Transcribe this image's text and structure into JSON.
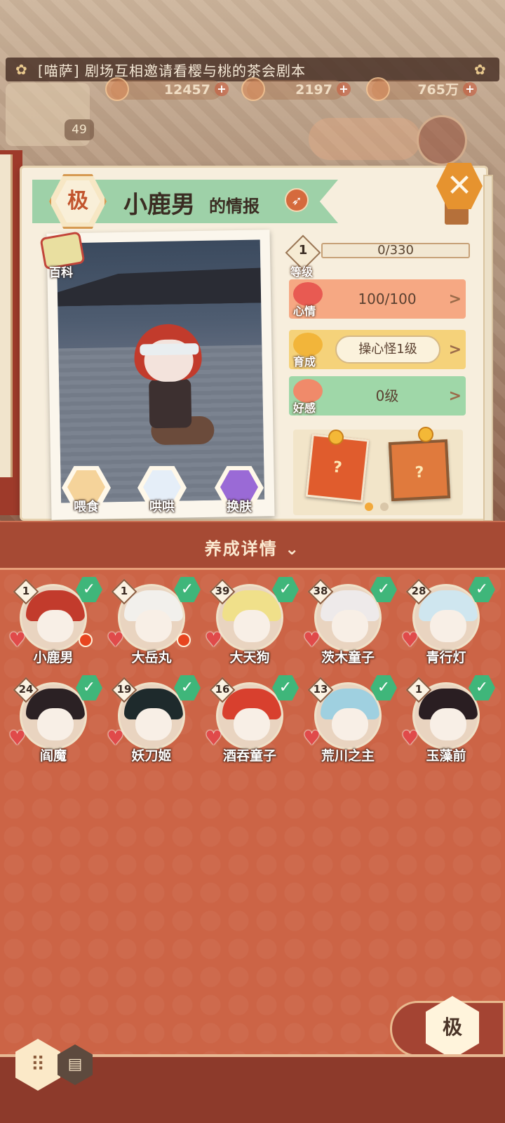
{
  "ticker": {
    "text": "[喵萨] 剧场互相邀请看樱与桃的茶会剧本"
  },
  "currencies": [
    {
      "icon": "food-icon",
      "value": "12457"
    },
    {
      "icon": "lantern-icon",
      "value": "2197"
    },
    {
      "icon": "coin-icon",
      "value": "765万"
    }
  ],
  "player": {
    "level": "49"
  },
  "info": {
    "grade": "极",
    "name": "小鹿男",
    "suffix": "的情报",
    "encyclopedia_label": "百科",
    "actions": [
      {
        "label": "喂食",
        "icon": "bowl-icon"
      },
      {
        "label": "哄哄",
        "icon": "milk-icon"
      },
      {
        "label": "换肤",
        "icon": "skin-icon"
      }
    ],
    "level": {
      "label": "等级",
      "value": "1",
      "exp": "0/330",
      "exp_fraction": 0
    },
    "mood": {
      "label": "心情",
      "value": "100/100"
    },
    "growth": {
      "label": "育成",
      "value": "操心怪1级"
    },
    "affection": {
      "label": "好感",
      "value": "0级"
    },
    "reward_cards": [
      "?",
      "?"
    ],
    "page_dots": {
      "active": 0,
      "count": 2
    }
  },
  "section": {
    "title": "养成详情"
  },
  "characters": [
    {
      "name": "小鹿男",
      "level": "1",
      "checked": true,
      "red_dot": true,
      "hair": "#c23b2c"
    },
    {
      "name": "大岳丸",
      "level": "1",
      "checked": true,
      "red_dot": true,
      "hair": "#f2f0ec"
    },
    {
      "name": "大天狗",
      "level": "39",
      "checked": true,
      "red_dot": false,
      "hair": "#f0e08a"
    },
    {
      "name": "茨木童子",
      "level": "38",
      "checked": true,
      "red_dot": false,
      "hair": "#eeeaea"
    },
    {
      "name": "青行灯",
      "level": "28",
      "checked": true,
      "red_dot": false,
      "hair": "#cfe6ef"
    },
    {
      "name": "阎魔",
      "level": "24",
      "checked": true,
      "red_dot": false,
      "hair": "#2b2124"
    },
    {
      "name": "妖刀姬",
      "level": "19",
      "checked": true,
      "red_dot": false,
      "hair": "#1e2a2c"
    },
    {
      "name": "酒吞童子",
      "level": "16",
      "checked": true,
      "red_dot": false,
      "hair": "#d8402e"
    },
    {
      "name": "荒川之主",
      "level": "13",
      "checked": true,
      "red_dot": false,
      "hair": "#9fd0e0"
    },
    {
      "name": "玉藻前",
      "level": "1",
      "checked": true,
      "red_dot": false,
      "hair": "#2a1e22"
    }
  ],
  "filter": {
    "grade_label": "极"
  },
  "view": {
    "grid_icon": "grid-view-icon",
    "list_icon": "list-view-icon"
  },
  "colors": {
    "mood_bg": "#f6a883",
    "growth_bg": "#f5d27a",
    "affection_bg": "#9fd7a8",
    "check": "#3fb67a",
    "accent": "#c2552e"
  }
}
